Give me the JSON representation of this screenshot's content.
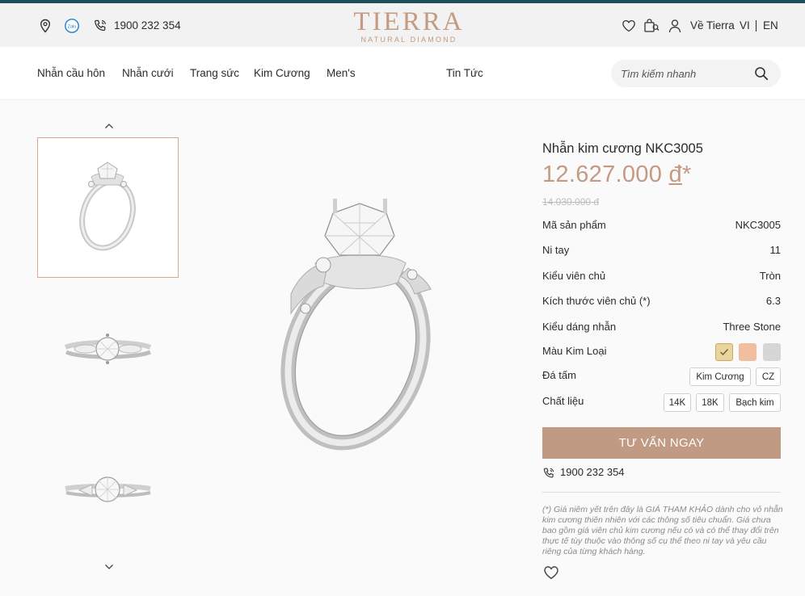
{
  "topbar": {
    "phone": "1900 232 354",
    "zalo_label": "Zalo",
    "icons": [
      "location-icon",
      "zalo-icon",
      "phone-icon",
      "heart-icon",
      "cart-icon",
      "user-icon"
    ],
    "about": "Về Tierra",
    "lang_vi": "VI",
    "lang_en": "EN"
  },
  "logo": {
    "main": "TIERRA",
    "sub": "NATURAL DIAMOND"
  },
  "nav": {
    "items": [
      "Nhẫn cầu hôn",
      "Nhẫn cưới",
      "Trang sức",
      "Kim Cương",
      "Men's",
      "Tin Tức"
    ],
    "search_placeholder": "Tìm kiếm nhanh"
  },
  "product": {
    "name": "Nhẫn kim cương NKC3005",
    "price": "12.627.000",
    "currency": "đ",
    "asterisk": "*",
    "old_price": "14.030.000 đ",
    "specs": [
      {
        "label": "Mã sản phẩm",
        "value": "NKC3005"
      },
      {
        "label": "Ni tay",
        "value": "11"
      },
      {
        "label": "Kiểu viên chủ",
        "value": "Tròn"
      },
      {
        "label": "Kích thước viên chủ (*)",
        "value": "6.3"
      },
      {
        "label": "Kiểu dáng nhẫn",
        "value": "Three Stone"
      }
    ],
    "metal_label": "Màu Kim Loại",
    "metal_colors": [
      "#e9d39a",
      "#f0c0a0",
      "#d6d6d6"
    ],
    "side_stone_label": "Đá tấm",
    "side_stones": [
      "Kim Cương",
      "CZ"
    ],
    "material_label": "Chất liệu",
    "materials": [
      "14K",
      "18K",
      "Bạch kim"
    ],
    "cta": "TƯ VẤN NGAY",
    "hotline": "1900 232 354",
    "note": "(*) Giá niêm yết trên đây là GIÁ THAM KHẢO dành cho vỏ nhẫn kim cương thiên nhiên với các thông số tiêu chuẩn. Giá chưa bao gồm giá viên chủ kim cương nếu có và có thể thay đổi trên thực tế tùy thuộc vào thông số cụ thể theo ni tay và yêu cầu riêng của từng khách hàng."
  },
  "colors": {
    "accent": "#c49a83",
    "button": "#c09a82"
  }
}
